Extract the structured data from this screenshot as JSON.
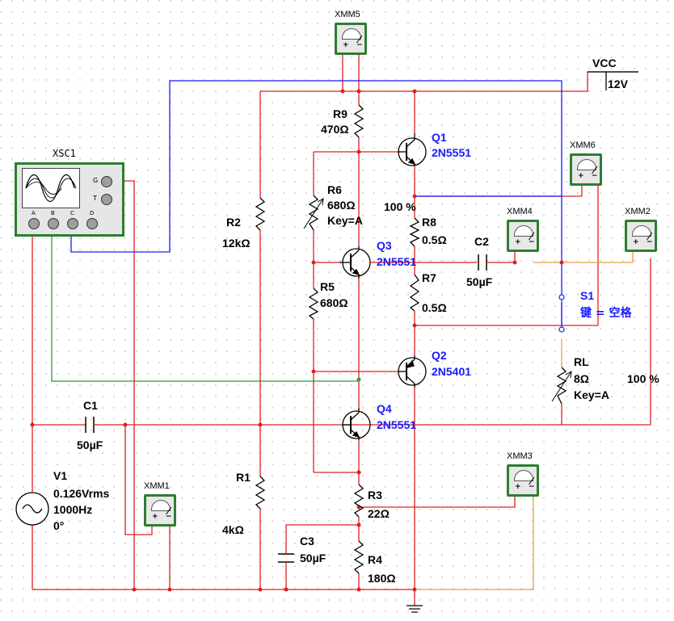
{
  "instruments": {
    "xsc1": "XSC1",
    "xmm1": "XMM1",
    "xmm2": "XMM2",
    "xmm3": "XMM3",
    "xmm4": "XMM4",
    "xmm5": "XMM5",
    "xmm6": "XMM6"
  },
  "scope_channels": [
    "A",
    "B",
    "C",
    "D"
  ],
  "scope_trig": [
    "G",
    "T"
  ],
  "meter_plus": "+",
  "meter_minus": "−",
  "supply": {
    "name": "VCC",
    "value": "12V"
  },
  "source": {
    "name": "V1",
    "amplitude": "0.126Vrms",
    "freq": "1000Hz",
    "phase": "0°"
  },
  "components": {
    "c1": {
      "name": "C1",
      "value": "50µF"
    },
    "c2": {
      "name": "C2",
      "value": "50µF"
    },
    "c3": {
      "name": "C3",
      "value": "50µF"
    },
    "r1": {
      "name": "R1",
      "value": "4kΩ"
    },
    "r2": {
      "name": "R2",
      "value": "12kΩ"
    },
    "r3": {
      "name": "R3",
      "value": "22Ω"
    },
    "r4": {
      "name": "R4",
      "value": "180Ω"
    },
    "r5": {
      "name": "R5",
      "value": "680Ω"
    },
    "r6": {
      "name": "R6",
      "value": "680Ω",
      "key": "Key=A",
      "percent": "100 %"
    },
    "r7": {
      "name": "R7",
      "value": "0.5Ω"
    },
    "r8": {
      "name": "R8",
      "value": "0.5Ω"
    },
    "r9": {
      "name": "R9",
      "value": "470Ω"
    },
    "rl": {
      "name": "RL",
      "value": "8Ω",
      "key": "Key=A",
      "percent": "100 %"
    },
    "s1": {
      "name": "S1",
      "key": "键 = 空格"
    },
    "q1": {
      "name": "Q1",
      "part": "2N5551"
    },
    "q2": {
      "name": "Q2",
      "part": "2N5401"
    },
    "q3": {
      "name": "Q3",
      "part": "2N5551"
    },
    "q4": {
      "name": "Q4",
      "part": "2N5551"
    }
  },
  "colors": {
    "wire_red": "#e02020",
    "wire_blue": "#1a1aff",
    "wire_green": "#2e9d2e",
    "wire_orange": "#e8a040",
    "label_blue": "#1a1aff",
    "grid_dot": "#c8c8c8"
  }
}
